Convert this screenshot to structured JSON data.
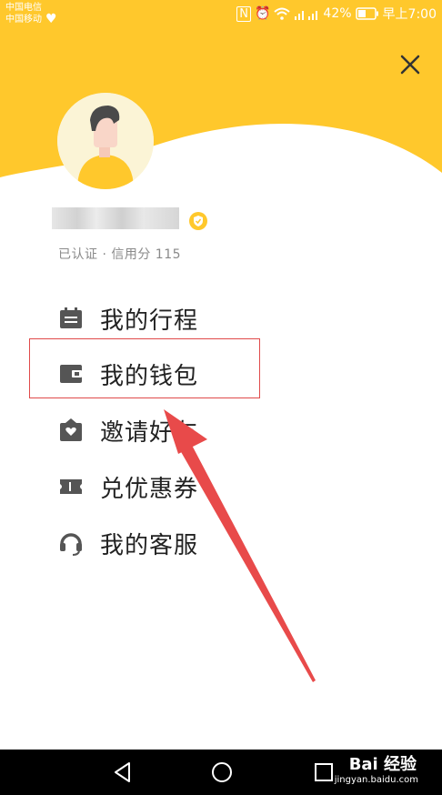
{
  "colors": {
    "accent": "#FFC82C",
    "text": "#222222",
    "muted": "#8a8a8a",
    "annotation": "#E84A4A"
  },
  "status_bar": {
    "carrier_1": "中国电信",
    "carrier_2": "中国移动",
    "battery": "42%",
    "time": "早上7:00"
  },
  "profile": {
    "verified_text": "已认证 · 信用分 115"
  },
  "menu": {
    "items": [
      {
        "label": "我的行程",
        "icon": "calendar-icon"
      },
      {
        "label": "我的钱包",
        "icon": "wallet-icon"
      },
      {
        "label": "邀请好友",
        "icon": "gift-heart-icon"
      },
      {
        "label": "兑优惠券",
        "icon": "ticket-icon"
      },
      {
        "label": "我的客服",
        "icon": "headset-icon"
      }
    ]
  },
  "watermark": {
    "brand": "Bai 经验",
    "url": "jingyan.baidu.com"
  }
}
